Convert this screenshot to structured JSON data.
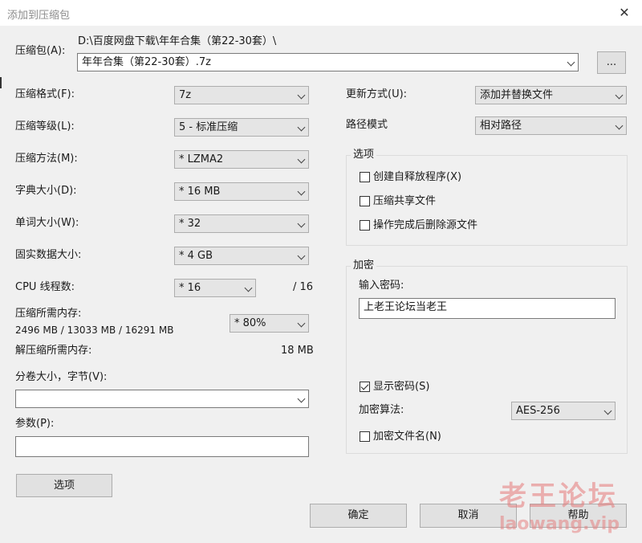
{
  "window": {
    "title": "添加到压缩包"
  },
  "archive": {
    "label": "压缩包(A):",
    "path": "D:\\百度网盘下载\\年年合集（第22-30套）\\",
    "name": "年年合集（第22-30套）.7z",
    "browse_label": "..."
  },
  "left": {
    "format_label": "压缩格式(F):",
    "format_value": "7z",
    "level_label": "压缩等级(L):",
    "level_value": "5 - 标准压缩",
    "method_label": "压缩方法(M):",
    "method_value": "* LZMA2",
    "dict_label": "字典大小(D):",
    "dict_value": "* 16 MB",
    "word_label": "单词大小(W):",
    "word_value": "* 32",
    "solid_label": "固实数据大小:",
    "solid_value": "* 4 GB",
    "threads_label": "CPU 线程数:",
    "threads_value": "* 16",
    "threads_max": "/ 16",
    "mem_label": "压缩所需内存:",
    "mem_values": "2496 MB / 13033 MB / 16291 MB",
    "mem_percent": "* 80%",
    "decomp_label": "解压缩所需内存:",
    "decomp_value": "18 MB",
    "volume_label": "分卷大小，字节(V):",
    "volume_value": "",
    "params_label": "参数(P):",
    "params_value": "",
    "options_button": "选项"
  },
  "right": {
    "update_label": "更新方式(U):",
    "update_value": "添加并替换文件",
    "path_mode_label": "路径模式",
    "path_mode_value": "相对路径",
    "options_group": "选项",
    "sfx_label": "创建自释放程序(X)",
    "shared_label": "压缩共享文件",
    "delete_label": "操作完成后删除源文件",
    "encrypt_group": "加密",
    "password_label": "输入密码:",
    "password_value": "上老王论坛当老王",
    "show_password_label": "显示密码(S)",
    "algo_label": "加密算法:",
    "algo_value": "AES-256",
    "encrypt_names_label": "加密文件名(N)"
  },
  "buttons": {
    "ok": "确定",
    "cancel": "取消",
    "help": "帮助"
  },
  "watermark": {
    "text": "老王论坛",
    "url": "laowang.vip"
  }
}
